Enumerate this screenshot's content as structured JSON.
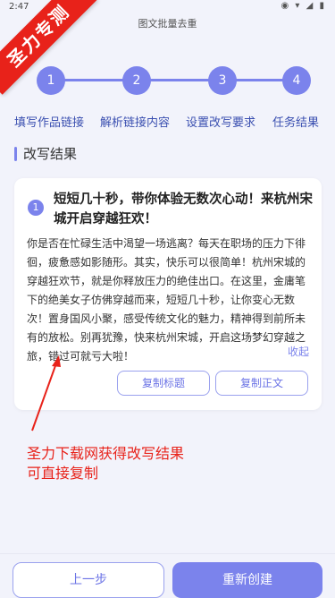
{
  "status": {
    "time": "2:47",
    "icons": "◉ ▾ ◢ ▮"
  },
  "header": {
    "title": "图文批量去重"
  },
  "watermark": {
    "text": "圣力专测"
  },
  "steps": [
    {
      "number": "1",
      "label": "填写作品链接"
    },
    {
      "number": "2",
      "label": "解析链接内容"
    },
    {
      "number": "3",
      "label": "设置改写要求"
    },
    {
      "number": "4",
      "label": "任务结果"
    }
  ],
  "section": {
    "title": "改写结果"
  },
  "result": {
    "index": "1",
    "title": "短短几十秒，带你体验无数次心动！来杭州宋城开启穿越狂欢！",
    "body": "你是否在忙碌生活中渴望一场逃离？每天在职场的压力下徘徊，疲惫感如影随形。其实，快乐可以很简单！杭州宋城的穿越狂欢节，就是你释放压力的绝佳出口。在这里，金庸笔下的绝美女子仿佛穿越而来，短短几十秒，让你变心无数次！置身国风小聚，感受传统文化的魅力，精神得到前所未有的放松。别再犹豫，快来杭州宋城，开启这场梦幻穿越之旅，错过可就亏大啦！",
    "collapse_label": "收起",
    "copy_title_label": "复制标题",
    "copy_body_label": "复制正文"
  },
  "annotation": {
    "line1": "圣力下载网获得改写结果",
    "line2": "可直接复制"
  },
  "footer": {
    "prev_label": "上一步",
    "recreate_label": "重新创建"
  },
  "colors": {
    "accent": "#7b83ec",
    "annotation": "#e8221a",
    "background": "#f2f3fb"
  }
}
